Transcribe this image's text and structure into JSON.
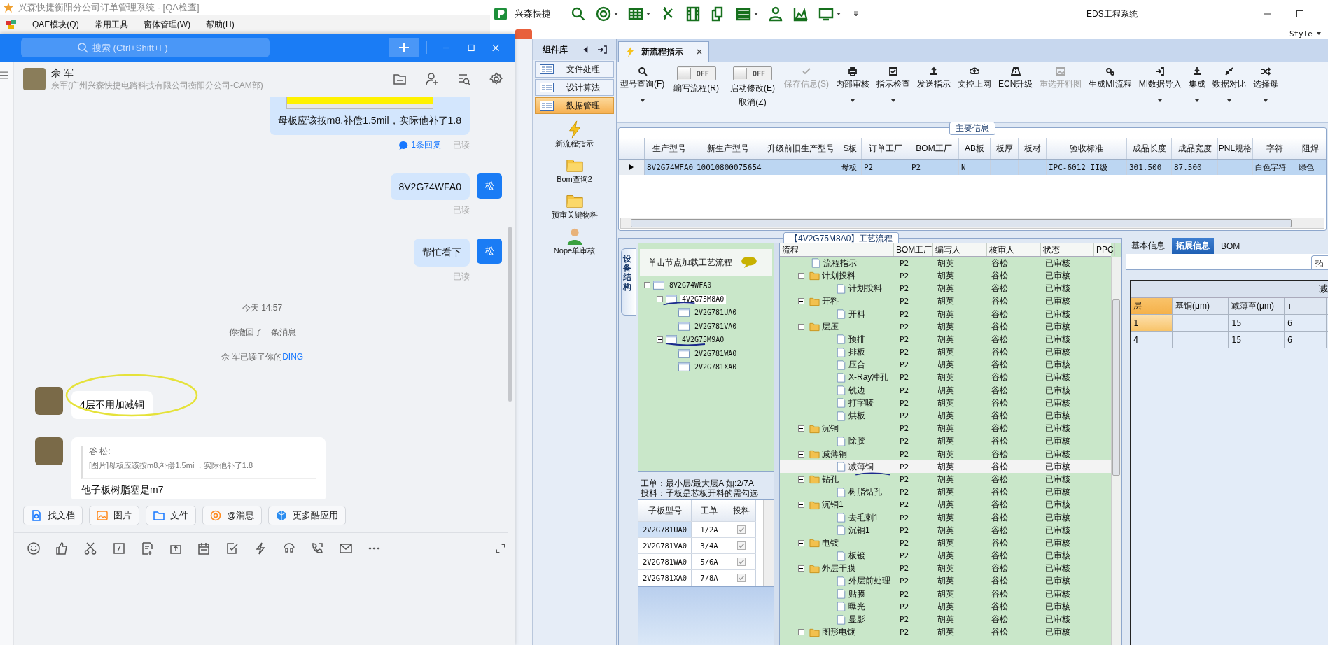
{
  "back_window": {
    "title": "兴森快捷衡阳分公司订单管理系统 - [QA检查]",
    "menu": [
      "QAE模块(Q)",
      "常用工具",
      "窗体管理(W)",
      "帮助(H)"
    ]
  },
  "chat": {
    "search": {
      "placeholder": "搜索 (Ctrl+Shift+F)"
    },
    "contact": {
      "name": "佘 军",
      "subtitle": "佘军(广州兴森快捷电路科技有限公司衡阳分公司-CAM部)"
    },
    "messages": [
      {
        "kind": "outgoing",
        "image": true,
        "text": "母板应该按m8,补偿1.5mil，实际他补了1.8",
        "replies": "1条回复",
        "receipt": "已读"
      },
      {
        "kind": "outgoing",
        "avatar": "松",
        "text": "8V2G74WFA0",
        "receipt": "已读"
      },
      {
        "kind": "outgoing",
        "avatar": "松",
        "text": "帮忙看下",
        "receipt": "已读"
      },
      {
        "kind": "time",
        "text": "今天 14:57"
      },
      {
        "kind": "notice",
        "text": "你撤回了一条消息"
      },
      {
        "kind": "notice",
        "text": "佘 军已读了你的",
        "link": "DING"
      },
      {
        "kind": "incoming",
        "text": "4层不用加减铜",
        "highlighted": true
      },
      {
        "kind": "quote",
        "quote_author": "谷 松:",
        "quote": "[图片]母板应该按m8,补偿1.5mil，实际他补了1.8",
        "text": "他子板树脂塞是m7"
      }
    ],
    "quick_actions": [
      "找文档",
      "图片",
      "文件",
      "@消息",
      "更多酷应用"
    ]
  },
  "eds": {
    "title": "EDS工程系统",
    "brand": "兴森快捷",
    "style_menu": "Style",
    "sidebar": {
      "title": "组件库",
      "items": [
        {
          "label": "文件处理",
          "selected": false
        },
        {
          "label": "设计算法",
          "selected": false
        },
        {
          "label": "数据管理",
          "selected": true
        }
      ],
      "tools": [
        "新流程指示",
        "Bom查询2",
        "预审关键物料",
        "Nope单审核"
      ]
    },
    "doc_tab": "新流程指示",
    "ribbon": [
      {
        "kind": "button",
        "label": "型号查询(F)",
        "dropdown": true,
        "disabled": false
      },
      {
        "kind": "toggle",
        "state": "OFF",
        "on": false,
        "label": "编写流程(R)"
      },
      {
        "kind": "toggle",
        "state": "OFF",
        "on": false,
        "label": "启动修改(E)",
        "label2": "取消(Z)"
      },
      {
        "kind": "button",
        "label": "保存信息(S)",
        "dropdown": false,
        "disabled": true
      },
      {
        "kind": "button",
        "label": "内部审核",
        "dropdown": true,
        "disabled": false
      },
      {
        "kind": "button",
        "label": "指示检查",
        "dropdown": true,
        "disabled": false
      },
      {
        "kind": "button",
        "label": "发送指示",
        "dropdown": false,
        "disabled": false
      },
      {
        "kind": "button",
        "label": "文控上网",
        "dropdown": false,
        "disabled": false
      },
      {
        "kind": "button",
        "label": "ECN升级",
        "dropdown": false,
        "disabled": false
      },
      {
        "kind": "button",
        "label": "重选开料图",
        "dropdown": false,
        "disabled": true
      },
      {
        "kind": "button",
        "label": "生成MI流程",
        "dropdown": false,
        "disabled": false
      },
      {
        "kind": "button",
        "label": "MI数据导入",
        "dropdown": true,
        "disabled": false
      },
      {
        "kind": "button",
        "label": "集成",
        "dropdown": true,
        "disabled": false
      },
      {
        "kind": "button",
        "label": "数据对比",
        "dropdown": true,
        "disabled": false
      },
      {
        "kind": "button",
        "label": "选择母",
        "dropdown": true,
        "disabled": false
      }
    ],
    "main_info": {
      "title": "主要信息",
      "columns": [
        "生产型号",
        "新生产型号",
        "升级前旧生产型号",
        "S板",
        "订单工厂",
        "BOM工厂",
        "AB板",
        "板厚",
        "板材",
        "验收标准",
        "成品长度",
        "成品宽度",
        "PNL规格",
        "字符",
        "阻焊"
      ],
      "rows": [
        {
          "selected": true,
          "cells": [
            "8V2G74WFA0",
            "10010800075654",
            null,
            "母板",
            "P2",
            "P2",
            "N",
            null,
            null,
            "IPC-6012 II级",
            "301.500",
            "87.500",
            null,
            "白色字符",
            "绿色"
          ]
        }
      ]
    },
    "process": {
      "title": "【4V2G75M8A0】工艺流程",
      "side_tab": "设备结构",
      "hint": "单击节点加载工艺流程",
      "tree": [
        {
          "label": "8V2G74WFA0",
          "selected": false,
          "expanded": true,
          "children": [
            {
              "label": "4V2G75M8A0",
              "selected": true,
              "expanded": true,
              "children": [
                {
                  "label": "2V2G781UA0",
                  "selected": false
                },
                {
                  "label": "2V2G781VA0",
                  "selected": false
                }
              ]
            },
            {
              "label": "4V2G75M9A0",
              "selected": false,
              "expanded": true,
              "children": [
                {
                  "label": "2V2G781WA0",
                  "selected": false
                },
                {
                  "label": "2V2G781XA0",
                  "selected": false
                }
              ]
            }
          ]
        }
      ],
      "notes": [
        "工单：最小层/最大层A 如:2/7A",
        "投料：子板是芯板开料的需勾选"
      ],
      "sub_table": {
        "columns": [
          "子板型号",
          "工单",
          "投料"
        ],
        "rows": [
          {
            "model": "2V2G781UA0",
            "order": "1/2A",
            "checked": true,
            "selected": true
          },
          {
            "model": "2V2G781VA0",
            "order": "3/4A",
            "checked": true,
            "selected": false
          },
          {
            "model": "2V2G781WA0",
            "order": "5/6A",
            "checked": true,
            "selected": false
          },
          {
            "model": "2V2G781XA0",
            "order": "7/8A",
            "checked": true,
            "selected": false
          }
        ]
      },
      "flow": {
        "columns": [
          "流程",
          "BOM工厂",
          "编写人",
          "核审人",
          "状态",
          "PPC"
        ],
        "rows": [
          {
            "kind": "step",
            "label": "流程指示",
            "bom": "P2",
            "writer": "胡英",
            "reviewer": "谷松",
            "status": "已审核",
            "selected": false
          },
          {
            "kind": "group",
            "label": "计划投料",
            "bom": "P2",
            "writer": "胡英",
            "reviewer": "谷松",
            "status": "已审核",
            "selected": false,
            "expanded": true,
            "children": [
              {
                "kind": "step",
                "label": "计划投料",
                "bom": "P2",
                "writer": "胡英",
                "reviewer": "谷松",
                "status": "已审核",
                "selected": false
              }
            ]
          },
          {
            "kind": "group",
            "label": "开料",
            "bom": "P2",
            "writer": "胡英",
            "reviewer": "谷松",
            "status": "已审核",
            "selected": false,
            "expanded": true,
            "children": [
              {
                "kind": "step",
                "label": "开料",
                "bom": "P2",
                "writer": "胡英",
                "reviewer": "谷松",
                "status": "已审核",
                "selected": false
              }
            ]
          },
          {
            "kind": "group",
            "label": "层压",
            "bom": "P2",
            "writer": "胡英",
            "reviewer": "谷松",
            "status": "已审核",
            "selected": false,
            "expanded": true,
            "children": [
              {
                "kind": "step",
                "label": "预排",
                "bom": "P2",
                "writer": "胡英",
                "reviewer": "谷松",
                "status": "已审核",
                "selected": false
              },
              {
                "kind": "step",
                "label": "排板",
                "bom": "P2",
                "writer": "胡英",
                "reviewer": "谷松",
                "status": "已审核",
                "selected": false
              },
              {
                "kind": "step",
                "label": "压合",
                "bom": "P2",
                "writer": "胡英",
                "reviewer": "谷松",
                "status": "已审核",
                "selected": false
              },
              {
                "kind": "step",
                "label": "X-Ray冲孔",
                "bom": "P2",
                "writer": "胡英",
                "reviewer": "谷松",
                "status": "已审核",
                "selected": false
              },
              {
                "kind": "step",
                "label": "铣边",
                "bom": "P2",
                "writer": "胡英",
                "reviewer": "谷松",
                "status": "已审核",
                "selected": false
              },
              {
                "kind": "step",
                "label": "打字唛",
                "bom": "P2",
                "writer": "胡英",
                "reviewer": "谷松",
                "status": "已审核",
                "selected": false
              },
              {
                "kind": "step",
                "label": "烘板",
                "bom": "P2",
                "writer": "胡英",
                "reviewer": "谷松",
                "status": "已审核",
                "selected": false
              }
            ]
          },
          {
            "kind": "group",
            "label": "沉铜",
            "bom": "P2",
            "writer": "胡英",
            "reviewer": "谷松",
            "status": "已审核",
            "selected": false,
            "expanded": true,
            "children": [
              {
                "kind": "step",
                "label": "除胶",
                "bom": "P2",
                "writer": "胡英",
                "reviewer": "谷松",
                "status": "已审核",
                "selected": false
              }
            ]
          },
          {
            "kind": "group",
            "label": "减薄铜",
            "bom": "P2",
            "writer": "胡英",
            "reviewer": "谷松",
            "status": "已审核",
            "selected": false,
            "expanded": true,
            "children": [
              {
                "kind": "step",
                "label": "减薄铜",
                "bom": "P2",
                "writer": "胡英",
                "reviewer": "谷松",
                "status": "已审核",
                "selected": true
              }
            ]
          },
          {
            "kind": "group",
            "label": "钻孔",
            "bom": "P2",
            "writer": "胡英",
            "reviewer": "谷松",
            "status": "已审核",
            "selected": false,
            "expanded": true,
            "children": [
              {
                "kind": "step",
                "label": "树脂钻孔",
                "bom": "P2",
                "writer": "胡英",
                "reviewer": "谷松",
                "status": "已审核",
                "selected": false
              }
            ]
          },
          {
            "kind": "group",
            "label": "沉铜1",
            "bom": "P2",
            "writer": "胡英",
            "reviewer": "谷松",
            "status": "已审核",
            "selected": false,
            "expanded": true,
            "children": [
              {
                "kind": "step",
                "label": "去毛刺1",
                "bom": "P2",
                "writer": "胡英",
                "reviewer": "谷松",
                "status": "已审核",
                "selected": false
              },
              {
                "kind": "step",
                "label": "沉铜1",
                "bom": "P2",
                "writer": "胡英",
                "reviewer": "谷松",
                "status": "已审核",
                "selected": false
              }
            ]
          },
          {
            "kind": "group",
            "label": "电镀",
            "bom": "P2",
            "writer": "胡英",
            "reviewer": "谷松",
            "status": "已审核",
            "selected": false,
            "expanded": true,
            "children": [
              {
                "kind": "step",
                "label": "板镀",
                "bom": "P2",
                "writer": "胡英",
                "reviewer": "谷松",
                "status": "已审核",
                "selected": false
              }
            ]
          },
          {
            "kind": "group",
            "label": "外层干膜",
            "bom": "P2",
            "writer": "胡英",
            "reviewer": "谷松",
            "status": "已审核",
            "selected": false,
            "expanded": true,
            "children": [
              {
                "kind": "step",
                "label": "外层前处理",
                "bom": "P2",
                "writer": "胡英",
                "reviewer": "谷松",
                "status": "已审核",
                "selected": false
              },
              {
                "kind": "step",
                "label": "贴膜",
                "bom": "P2",
                "writer": "胡英",
                "reviewer": "谷松",
                "status": "已审核",
                "selected": false
              },
              {
                "kind": "step",
                "label": "曝光",
                "bom": "P2",
                "writer": "胡英",
                "reviewer": "谷松",
                "status": "已审核",
                "selected": false
              },
              {
                "kind": "step",
                "label": "显影",
                "bom": "P2",
                "writer": "胡英",
                "reviewer": "谷松",
                "status": "已审核",
                "selected": false
              }
            ]
          },
          {
            "kind": "group",
            "label": "图形电镀",
            "bom": "P2",
            "writer": "胡英",
            "reviewer": "谷松",
            "status": "已审核",
            "selected": false,
            "expanded": true
          }
        ]
      }
    },
    "detail": {
      "tabs": [
        {
          "label": "基本信息",
          "selected": false
        },
        {
          "label": "拓展信息",
          "selected": true
        },
        {
          "label": "BOM",
          "selected": false
        }
      ],
      "sub_tab": "拓",
      "grid": {
        "group_header": "减",
        "columns": [
          "层",
          "基铜(μm)",
          "减薄至(μm)",
          "+"
        ],
        "rows": [
          {
            "selected": true,
            "cells": [
              "1",
              null,
              "15",
              "6"
            ]
          },
          {
            "selected": false,
            "cells": [
              "4",
              null,
              "15",
              "6"
            ]
          }
        ]
      }
    }
  }
}
